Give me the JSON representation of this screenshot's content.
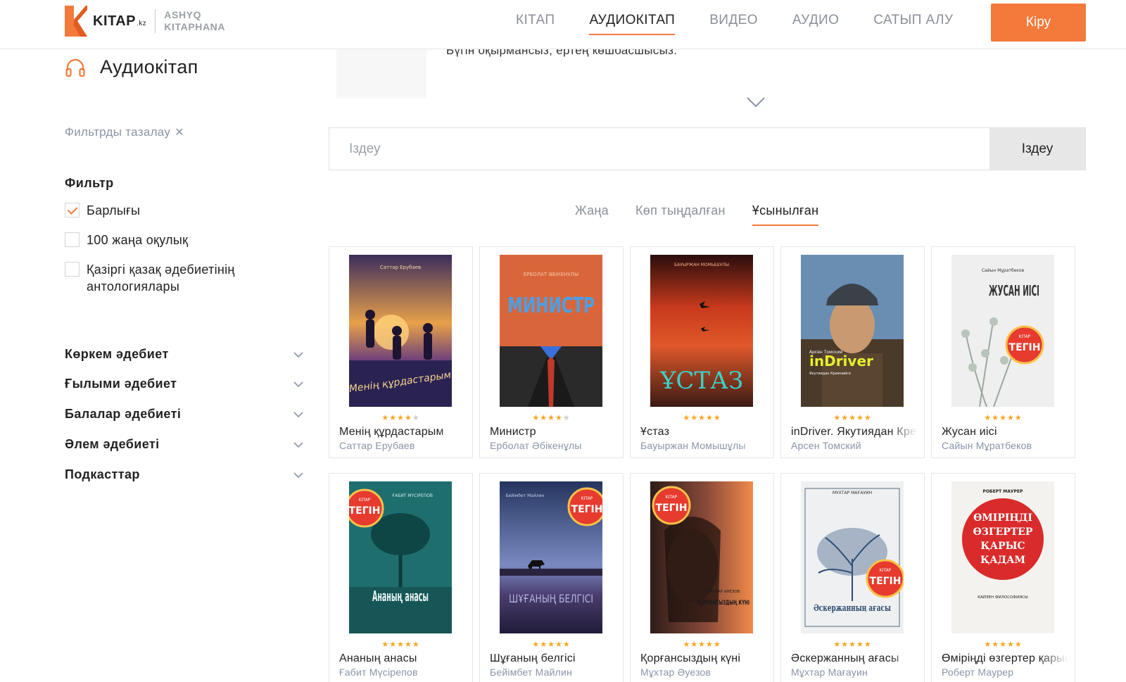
{
  "header": {
    "logo_text": "KITAP",
    "logo_suffix": ".kz",
    "logo_sub1": "ASHYQ",
    "logo_sub2": "KITAPHANA",
    "nav": [
      "КІТАП",
      "АУДИОКІТАП",
      "ВИДЕО",
      "АУДИО",
      "САТЫП АЛУ"
    ],
    "active_nav": "АУДИОКІТАП",
    "login_label": "Кіру"
  },
  "page": {
    "title": "Аудиокітап",
    "description_text": "Бүгін оқырмансыз, ертең көшбасшысыз."
  },
  "sidebar": {
    "clear_filter": "Фильтрды тазалау",
    "filter_title": "Фильтр",
    "checkboxes": [
      {
        "label": "Барлығы",
        "checked": true
      },
      {
        "label": "100 жаңа оқулық",
        "checked": false
      },
      {
        "label": "Қазіргі қазақ әдебиетінің антологиялары",
        "checked": false
      }
    ],
    "categories": [
      "Көркем әдебиет",
      "Ғылыми әдебиет",
      "Балалар әдебиеті",
      "Әлем әдебиеті",
      "Подкасттар"
    ]
  },
  "search": {
    "placeholder": "Іздеу",
    "button_label": "Іздеу"
  },
  "tabs": {
    "items": [
      "Жаңа",
      "Көп тыңдалған",
      "Ұсынылған"
    ],
    "active": "Ұсынылған"
  },
  "books": [
    {
      "title": "Менің құрдастарым",
      "author": "Саттар Ерубаев",
      "rating": 4,
      "cover_author": "Саттар Ерубаев",
      "cover_title": "Менің құрдастарым",
      "free": false
    },
    {
      "title": "Министр",
      "author": "Ерболат Әбікенұлы",
      "rating": 4,
      "cover_author": "ЕРБОЛАТ ӘБІКЕНҰЛЫ",
      "cover_title": "МИНИСТР",
      "free": false
    },
    {
      "title": "Ұстаз",
      "author": "Бауыржан Момышұлы",
      "rating": 5,
      "cover_author": "БАУЫРЖАН МОМЫШҰЛЫ",
      "cover_title": "ҰСТАЗ",
      "free": false
    },
    {
      "title": "inDriver. Якутиядан Кремнийге",
      "author": "Арсен Томский",
      "rating": 5,
      "cover_author": "Арсен Томский",
      "cover_title": "inDriver",
      "free": false
    },
    {
      "title": "Жусан иісі",
      "author": "Сайын Мұратбеков",
      "rating": 5,
      "cover_author": "Сайын Мұратбеков",
      "cover_title": "ЖУСАН ИІСІ",
      "free": true
    },
    {
      "title": "Ананың анасы",
      "author": "Ғабит Мүсірепов",
      "rating": 5,
      "cover_author": "ҒАБИТ МҮСІРЕПОВ",
      "cover_title": "Ананың анасы",
      "free": true
    },
    {
      "title": "Шұғаның белгісі",
      "author": "Бейімбет Майлин",
      "rating": 5,
      "cover_author": "Бейімбет Майлин",
      "cover_title": "ШҰҒАНЫҢ БЕЛГІСІ",
      "free": true
    },
    {
      "title": "Қорғансыздың күні",
      "author": "Мұхтар Әуезов",
      "rating": 5,
      "cover_author": "МҰХТАР ӘУЕЗОВ",
      "cover_title": "ҚОРҒАНСЫЗДЫҢ КҮНІ",
      "free": true
    },
    {
      "title": "Әскержанның ағасы",
      "author": "Мұхтар Мағауин",
      "rating": 5,
      "cover_author": "МҰХТАР МАҒАУИН",
      "cover_title": "Әскержанның ағасы",
      "free": true
    },
    {
      "title": "Өміріңді өзгертер қарыс қадам",
      "author": "Роберт Маурер",
      "rating": 5,
      "cover_author": "РОБЕРТ МАУРЕР",
      "cover_title": "ӨМІРІҢДІ ӨЗГЕРТЕР ҚАРЫС ҚАДАМ",
      "free": false
    }
  ],
  "badge_label": "ТЕГІН",
  "colors": {
    "accent": "#f47a3c",
    "muted": "#8a94a6",
    "star": "#f5a623"
  }
}
